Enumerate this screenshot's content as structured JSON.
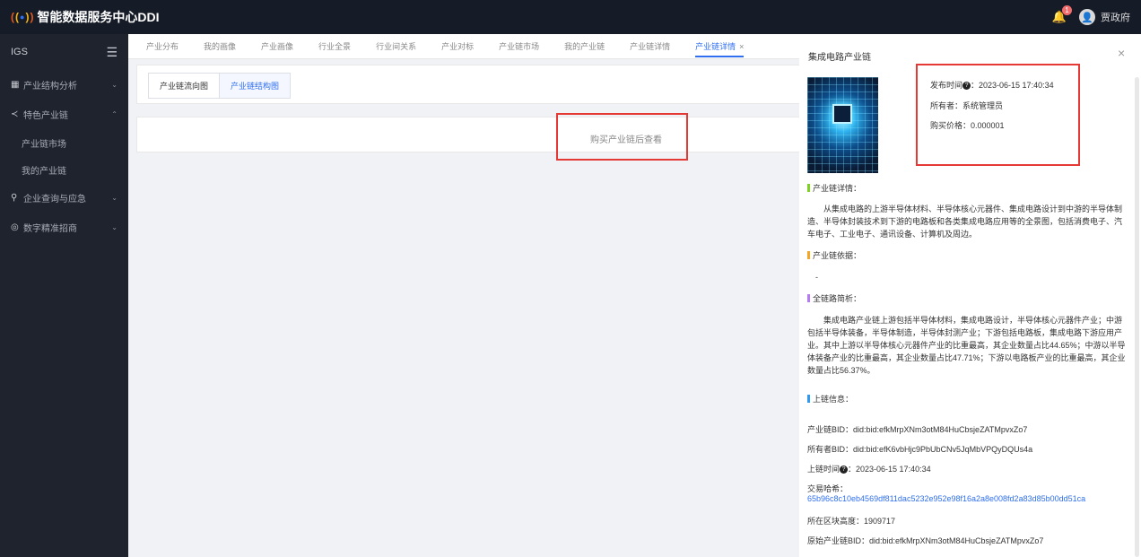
{
  "header": {
    "title": "智能数据服务中心DDI",
    "notification_count": "1",
    "username": "贾政府"
  },
  "sidebar": {
    "title": "IGS",
    "items": [
      {
        "label": "产业结构分析"
      },
      {
        "label": "特色产业链"
      },
      {
        "label": "产业链市场"
      },
      {
        "label": "我的产业链"
      },
      {
        "label": "企业查询与应急"
      },
      {
        "label": "数字精准招商"
      }
    ]
  },
  "tabs": [
    {
      "label": "产业分布"
    },
    {
      "label": "我的画像"
    },
    {
      "label": "产业画像"
    },
    {
      "label": "行业全景"
    },
    {
      "label": "行业间关系"
    },
    {
      "label": "产业对标"
    },
    {
      "label": "产业链市场"
    },
    {
      "label": "我的产业链"
    },
    {
      "label": "产业链详情"
    },
    {
      "label": "产业链详情"
    }
  ],
  "subtabs": [
    "产业链流向图",
    "产业链结构图"
  ],
  "main": {
    "buy_hint": "购买产业链后查看"
  },
  "drawer": {
    "title": "集成电路产业链",
    "publish_label": "发布时间",
    "publish_time": "：2023-06-15 17:40:34",
    "owner": "所有者：系统管理员",
    "price": "购买价格：0.000001",
    "detail_title": "产业链详情：",
    "detail_text": "从集成电路的上游半导体材料、半导体核心元器件、集成电路设计到中游的半导体制造、半导体封装技术到下游的电路板和各类集成电路应用等的全景图，包括消费电子、汽车电子、工业电子、通讯设备、计算机及周边。",
    "basis_title": "产业链依据：",
    "basis_text": "-",
    "analysis_title": "全链路简析：",
    "analysis_text": "集成电路产业链上游包括半导体材料，集成电路设计，半导体核心元器件产业；中游包括半导体装备，半导体制造，半导体封测产业；下游包括电路板，集成电路下游应用产业。其中上游以半导体核心元器件产业的比重最高，其企业数量占比44.65%；中游以半导体装备产业的比重最高，其企业数量占比47.71%；下游以电路板产业的比重最高，其企业数量占比56.37%。",
    "chain_title": "上链信息：",
    "chain_bid": "产业链BID：did:bid:efkMrpXNm3otM84HuCbsjeZATMpvxZo7",
    "owner_bid": "所有者BID：did:bid:efK6vbHjc9PbUbCNv5JqMbVPQyDQUs4a",
    "chain_time_label": "上链时间",
    "chain_time": "：2023-06-15 17:40:34",
    "tx_label": "交易哈希：",
    "tx_hash": "65b96c8c10eb4569df811dac5232e952e98f16a2a8e008fd2a83d85b00dd51ca",
    "block_height": "所在区块高度：1909717",
    "orig_bid": "原始产业链BID：did:bid:efkMrpXNm3otM84HuCbsjeZATMpvxZo7"
  },
  "colors": {
    "accent": "#2f6ff0",
    "header_bg": "#151b27",
    "sidebar_bg": "#1f232d",
    "highlight_red": "#e53935",
    "bar_green": "#7ed321",
    "bar_orange": "#f5a623",
    "bar_purple": "#b57bf5",
    "bar_blue": "#2f9bf0"
  }
}
